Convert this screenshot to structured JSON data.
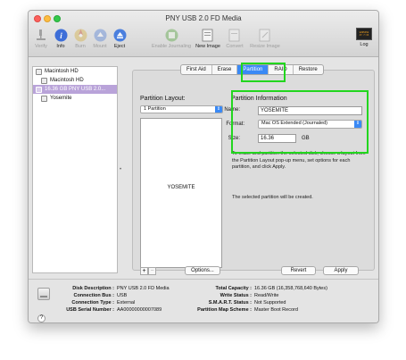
{
  "window": {
    "title": "PNY USB 2.0 FD Media"
  },
  "toolbar": {
    "items": [
      {
        "label": "Verify",
        "icon": "microscope-icon",
        "enabled": false
      },
      {
        "label": "Info",
        "icon": "info-icon",
        "enabled": true
      },
      {
        "label": "Burn",
        "icon": "burn-disc-icon",
        "enabled": false
      },
      {
        "label": "Mount",
        "icon": "mount-icon",
        "enabled": false
      },
      {
        "label": "Eject",
        "icon": "eject-icon",
        "enabled": true
      },
      {
        "label": "Enable Journaling",
        "icon": "journal-icon",
        "enabled": false
      },
      {
        "label": "New Image",
        "icon": "new-image-icon",
        "enabled": true
      },
      {
        "label": "Convert",
        "icon": "convert-icon",
        "enabled": false
      },
      {
        "label": "Resize Image",
        "icon": "resize-image-icon",
        "enabled": false
      }
    ],
    "log_label": "Log",
    "log_icon_text": "WARNING\nAY 7:36"
  },
  "sidebar": {
    "items": [
      {
        "label": "Macintosh HD",
        "level": 0,
        "selected": false
      },
      {
        "label": "Macintosh HD",
        "level": 1,
        "selected": false
      },
      {
        "label": "16.36 GB PNY USB 2.0...",
        "level": 0,
        "selected": true
      },
      {
        "label": "Yosemite",
        "level": 1,
        "selected": false
      }
    ]
  },
  "tabs": [
    {
      "label": "First Aid",
      "active": false
    },
    {
      "label": "Erase",
      "active": false
    },
    {
      "label": "Partition",
      "active": true
    },
    {
      "label": "RAID",
      "active": false
    },
    {
      "label": "Restore",
      "active": false
    }
  ],
  "partition": {
    "layout_heading": "Partition Layout:",
    "layout_value": "1 Partition",
    "info_heading": "Partition Information",
    "partition_block_name": "YOSEMITE",
    "name_label": "Name:",
    "name_value": "YOSEMITE",
    "format_label": "Format:",
    "format_value": "Mac OS Extended (Journaled)",
    "size_label": "Size:",
    "size_value": "16.36",
    "size_unit": "GB",
    "instructions": "To erase and partition the selected disk, choose a layout from the Partition Layout pop-up menu, set options for each partition, and click Apply.",
    "status_text": "The selected partition will be created.",
    "add_label": "+",
    "remove_label": "−",
    "options_label": "Options...",
    "revert_label": "Revert",
    "apply_label": "Apply"
  },
  "details": {
    "left": [
      {
        "key": "Disk Description :",
        "value": "PNY USB 2.0 FD Media"
      },
      {
        "key": "Connection Bus :",
        "value": "USB"
      },
      {
        "key": "Connection Type :",
        "value": "External"
      },
      {
        "key": "USB Serial Number :",
        "value": "AA00000000007089"
      }
    ],
    "right": [
      {
        "key": "Total Capacity :",
        "value": "16.36 GB (16,358,768,640 Bytes)"
      },
      {
        "key": "Write Status :",
        "value": "Read/Write"
      },
      {
        "key": "S.M.A.R.T. Status :",
        "value": "Not Supported"
      },
      {
        "key": "Partition Map Scheme :",
        "value": "Master Boot Record"
      }
    ],
    "help_label": "?"
  },
  "colors": {
    "selection": "#b9a3d9",
    "accent": "#3a89f5",
    "highlight": "#22d61e"
  }
}
